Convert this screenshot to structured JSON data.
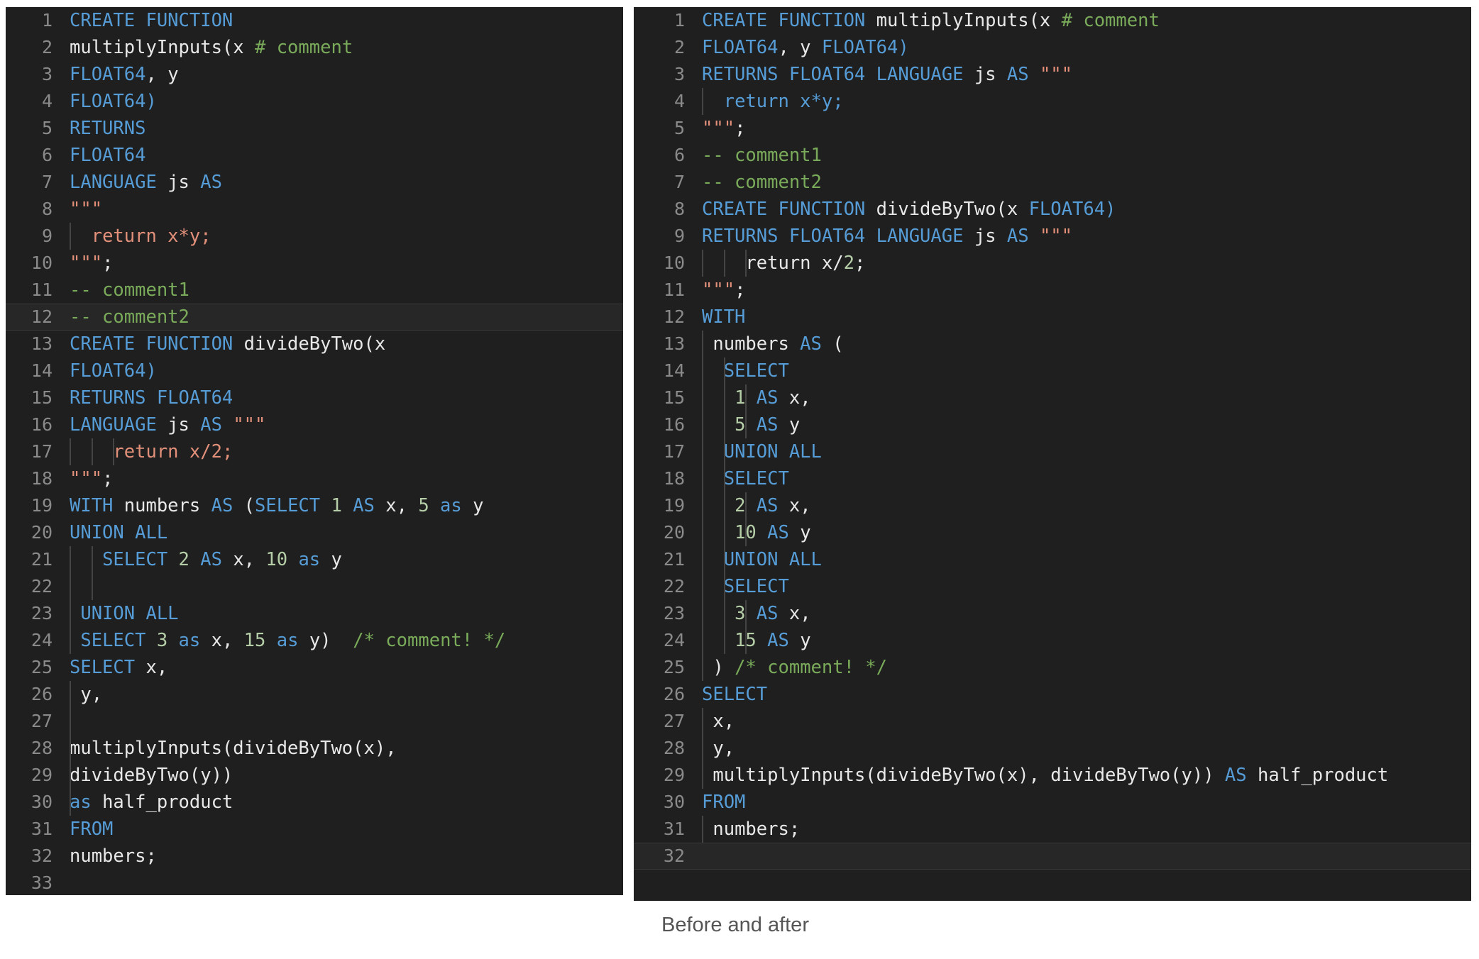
{
  "caption": "Before and after",
  "colors": {
    "editor_background": "#1f1f1f",
    "gutter_text": "#8a8a8a",
    "keyword": "#569cd6",
    "identifier": "#e8e8e8",
    "number": "#b5cea8",
    "string": "#e2907a",
    "comment": "#7aab5a",
    "current_line": "#272727",
    "indent_guide": "#444444",
    "caption_text": "#555555",
    "page_background": "#ffffff"
  },
  "editors": [
    {
      "name": "before",
      "total_lines": 33,
      "current_line": 12,
      "lines": [
        {
          "n": 1,
          "guides": 0,
          "tokens": [
            {
              "t": "CREATE FUNCTION",
              "c": "kw"
            }
          ]
        },
        {
          "n": 2,
          "guides": 0,
          "tokens": [
            {
              "t": "multiplyInputs(x ",
              "c": "id"
            },
            {
              "t": "# comment",
              "c": "com"
            }
          ]
        },
        {
          "n": 3,
          "guides": 0,
          "tokens": [
            {
              "t": "FLOAT64",
              "c": "kw"
            },
            {
              "t": ", ",
              "c": "id"
            },
            {
              "t": "y",
              "c": "id"
            }
          ]
        },
        {
          "n": 4,
          "guides": 0,
          "tokens": [
            {
              "t": "FLOAT64)",
              "c": "kw"
            }
          ]
        },
        {
          "n": 5,
          "guides": 0,
          "tokens": [
            {
              "t": "RETURNS",
              "c": "kw"
            }
          ]
        },
        {
          "n": 6,
          "guides": 0,
          "tokens": [
            {
              "t": "FLOAT64",
              "c": "kw"
            }
          ]
        },
        {
          "n": 7,
          "guides": 0,
          "tokens": [
            {
              "t": "LANGUAGE ",
              "c": "kw"
            },
            {
              "t": "js",
              "c": "id"
            },
            {
              "t": " AS",
              "c": "kw"
            }
          ]
        },
        {
          "n": 8,
          "guides": 0,
          "tokens": [
            {
              "t": "\"\"\"",
              "c": "str"
            }
          ]
        },
        {
          "n": 9,
          "guides": 1,
          "tokens": [
            {
              "t": "  ",
              "c": "plain"
            },
            {
              "t": "return x*y;",
              "c": "str"
            }
          ]
        },
        {
          "n": 10,
          "guides": 0,
          "tokens": [
            {
              "t": "\"\"\"",
              "c": "str"
            },
            {
              "t": ";",
              "c": "id"
            }
          ]
        },
        {
          "n": 11,
          "guides": 0,
          "tokens": [
            {
              "t": "-- comment1",
              "c": "com"
            }
          ]
        },
        {
          "n": 12,
          "guides": 0,
          "tokens": [
            {
              "t": "-- comment2",
              "c": "com"
            }
          ]
        },
        {
          "n": 13,
          "guides": 0,
          "tokens": [
            {
              "t": "CREATE FUNCTION ",
              "c": "kw"
            },
            {
              "t": "divideByTwo(x",
              "c": "id"
            }
          ]
        },
        {
          "n": 14,
          "guides": 0,
          "tokens": [
            {
              "t": "FLOAT64)",
              "c": "kw"
            }
          ]
        },
        {
          "n": 15,
          "guides": 0,
          "tokens": [
            {
              "t": "RETURNS FLOAT64",
              "c": "kw"
            }
          ]
        },
        {
          "n": 16,
          "guides": 0,
          "tokens": [
            {
              "t": "LANGUAGE ",
              "c": "kw"
            },
            {
              "t": "js",
              "c": "id"
            },
            {
              "t": " AS ",
              "c": "kw"
            },
            {
              "t": "\"\"\"",
              "c": "str"
            }
          ]
        },
        {
          "n": 17,
          "guides": 3,
          "tokens": [
            {
              "t": "    ",
              "c": "plain"
            },
            {
              "t": "return x/2;",
              "c": "str"
            }
          ]
        },
        {
          "n": 18,
          "guides": 0,
          "tokens": [
            {
              "t": "\"\"\"",
              "c": "str"
            },
            {
              "t": ";",
              "c": "id"
            }
          ]
        },
        {
          "n": 19,
          "guides": 0,
          "tokens": [
            {
              "t": "WITH ",
              "c": "kw"
            },
            {
              "t": "numbers",
              "c": "id"
            },
            {
              "t": " AS ",
              "c": "kw"
            },
            {
              "t": "(",
              "c": "id"
            },
            {
              "t": "SELECT ",
              "c": "kw"
            },
            {
              "t": "1",
              "c": "num"
            },
            {
              "t": " AS ",
              "c": "kw"
            },
            {
              "t": "x, ",
              "c": "id"
            },
            {
              "t": "5",
              "c": "num"
            },
            {
              "t": " as ",
              "c": "kw"
            },
            {
              "t": "y",
              "c": "id"
            }
          ]
        },
        {
          "n": 20,
          "guides": 0,
          "tokens": [
            {
              "t": "UNION ALL",
              "c": "kw"
            }
          ]
        },
        {
          "n": 21,
          "guides": 2,
          "tokens": [
            {
              "t": "   ",
              "c": "plain"
            },
            {
              "t": "SELECT ",
              "c": "kw"
            },
            {
              "t": "2",
              "c": "num"
            },
            {
              "t": " AS ",
              "c": "kw"
            },
            {
              "t": "x, ",
              "c": "id"
            },
            {
              "t": "10",
              "c": "num"
            },
            {
              "t": " as ",
              "c": "kw"
            },
            {
              "t": "y",
              "c": "id"
            }
          ]
        },
        {
          "n": 22,
          "guides": 2,
          "tokens": []
        },
        {
          "n": 23,
          "guides": 1,
          "tokens": [
            {
              "t": " ",
              "c": "plain"
            },
            {
              "t": "UNION ALL",
              "c": "kw"
            }
          ]
        },
        {
          "n": 24,
          "guides": 1,
          "tokens": [
            {
              "t": " ",
              "c": "plain"
            },
            {
              "t": "SELECT ",
              "c": "kw"
            },
            {
              "t": "3",
              "c": "num"
            },
            {
              "t": " as ",
              "c": "kw"
            },
            {
              "t": "x, ",
              "c": "id"
            },
            {
              "t": "15",
              "c": "num"
            },
            {
              "t": " as ",
              "c": "kw"
            },
            {
              "t": "y)",
              "c": "id"
            },
            {
              "t": "  ",
              "c": "plain"
            },
            {
              "t": "/* comment! */",
              "c": "com"
            }
          ]
        },
        {
          "n": 25,
          "guides": 0,
          "tokens": [
            {
              "t": "SELECT ",
              "c": "kw"
            },
            {
              "t": "x,",
              "c": "id"
            }
          ]
        },
        {
          "n": 26,
          "guides": 1,
          "tokens": [
            {
              "t": " ",
              "c": "plain"
            },
            {
              "t": "y,",
              "c": "id"
            }
          ]
        },
        {
          "n": 27,
          "guides": 1,
          "tokens": []
        },
        {
          "n": 28,
          "guides": 1,
          "tokens": [
            {
              "t": "multiplyInputs(divideByTwo(x),",
              "c": "id"
            }
          ]
        },
        {
          "n": 29,
          "guides": 1,
          "tokens": [
            {
              "t": "divideByTwo(y))",
              "c": "id"
            }
          ]
        },
        {
          "n": 30,
          "guides": 1,
          "tokens": [
            {
              "t": "as ",
              "c": "kw"
            },
            {
              "t": "half_product",
              "c": "id"
            }
          ]
        },
        {
          "n": 31,
          "guides": 0,
          "tokens": [
            {
              "t": "FROM",
              "c": "kw"
            }
          ]
        },
        {
          "n": 32,
          "guides": 0,
          "tokens": [
            {
              "t": "numbers;",
              "c": "id"
            }
          ]
        },
        {
          "n": 33,
          "guides": 0,
          "tokens": []
        }
      ]
    },
    {
      "name": "after",
      "total_lines": 32,
      "current_line": 32,
      "lines": [
        {
          "n": 1,
          "guides": 0,
          "tokens": [
            {
              "t": "CREATE FUNCTION ",
              "c": "kw"
            },
            {
              "t": "multiplyInputs(x ",
              "c": "id"
            },
            {
              "t": "# comment",
              "c": "com"
            }
          ]
        },
        {
          "n": 2,
          "guides": 0,
          "tokens": [
            {
              "t": "FLOAT64",
              "c": "kw"
            },
            {
              "t": ", y ",
              "c": "id"
            },
            {
              "t": "FLOAT64)",
              "c": "kw"
            }
          ]
        },
        {
          "n": 3,
          "guides": 0,
          "tokens": [
            {
              "t": "RETURNS FLOAT64 LANGUAGE ",
              "c": "kw"
            },
            {
              "t": "js",
              "c": "id"
            },
            {
              "t": " AS ",
              "c": "kw"
            },
            {
              "t": "\"\"\"",
              "c": "str"
            }
          ]
        },
        {
          "n": 4,
          "guides": 1,
          "tokens": [
            {
              "t": "  ",
              "c": "plain"
            },
            {
              "t": "return x*y;",
              "c": "kw"
            }
          ]
        },
        {
          "n": 5,
          "guides": 0,
          "tokens": [
            {
              "t": "\"\"\"",
              "c": "str"
            },
            {
              "t": ";",
              "c": "id"
            }
          ]
        },
        {
          "n": 6,
          "guides": 0,
          "tokens": [
            {
              "t": "-- comment1",
              "c": "com"
            }
          ]
        },
        {
          "n": 7,
          "guides": 0,
          "tokens": [
            {
              "t": "-- comment2",
              "c": "com"
            }
          ]
        },
        {
          "n": 8,
          "guides": 0,
          "tokens": [
            {
              "t": "CREATE FUNCTION ",
              "c": "kw"
            },
            {
              "t": "divideByTwo(x ",
              "c": "id"
            },
            {
              "t": "FLOAT64)",
              "c": "kw"
            }
          ]
        },
        {
          "n": 9,
          "guides": 0,
          "tokens": [
            {
              "t": "RETURNS FLOAT64 LANGUAGE ",
              "c": "kw"
            },
            {
              "t": "js",
              "c": "id"
            },
            {
              "t": " AS ",
              "c": "kw"
            },
            {
              "t": "\"\"\"",
              "c": "str"
            }
          ]
        },
        {
          "n": 10,
          "guides": 3,
          "tokens": [
            {
              "t": "    ",
              "c": "plain"
            },
            {
              "t": "return x/",
              "c": "id"
            },
            {
              "t": "2",
              "c": "num"
            },
            {
              "t": ";",
              "c": "id"
            }
          ]
        },
        {
          "n": 11,
          "guides": 0,
          "tokens": [
            {
              "t": "\"\"\"",
              "c": "str"
            },
            {
              "t": ";",
              "c": "id"
            }
          ]
        },
        {
          "n": 12,
          "guides": 0,
          "tokens": [
            {
              "t": "WITH",
              "c": "kw"
            }
          ]
        },
        {
          "n": 13,
          "guides": 1,
          "tokens": [
            {
              "t": " ",
              "c": "plain"
            },
            {
              "t": "numbers",
              "c": "id"
            },
            {
              "t": " AS ",
              "c": "kw"
            },
            {
              "t": "(",
              "c": "id"
            }
          ]
        },
        {
          "n": 14,
          "guides": 2,
          "tokens": [
            {
              "t": "  ",
              "c": "plain"
            },
            {
              "t": "SELECT",
              "c": "kw"
            }
          ]
        },
        {
          "n": 15,
          "guides": 3,
          "tokens": [
            {
              "t": "   ",
              "c": "plain"
            },
            {
              "t": "1",
              "c": "num"
            },
            {
              "t": " AS ",
              "c": "kw"
            },
            {
              "t": "x,",
              "c": "id"
            }
          ]
        },
        {
          "n": 16,
          "guides": 3,
          "tokens": [
            {
              "t": "   ",
              "c": "plain"
            },
            {
              "t": "5",
              "c": "num"
            },
            {
              "t": " AS ",
              "c": "kw"
            },
            {
              "t": "y",
              "c": "id"
            }
          ]
        },
        {
          "n": 17,
          "guides": 2,
          "tokens": [
            {
              "t": "  ",
              "c": "plain"
            },
            {
              "t": "UNION ALL",
              "c": "kw"
            }
          ]
        },
        {
          "n": 18,
          "guides": 2,
          "tokens": [
            {
              "t": "  ",
              "c": "plain"
            },
            {
              "t": "SELECT",
              "c": "kw"
            }
          ]
        },
        {
          "n": 19,
          "guides": 3,
          "tokens": [
            {
              "t": "   ",
              "c": "plain"
            },
            {
              "t": "2",
              "c": "num"
            },
            {
              "t": " AS ",
              "c": "kw"
            },
            {
              "t": "x,",
              "c": "id"
            }
          ]
        },
        {
          "n": 20,
          "guides": 3,
          "tokens": [
            {
              "t": "   ",
              "c": "plain"
            },
            {
              "t": "10",
              "c": "num"
            },
            {
              "t": " AS ",
              "c": "kw"
            },
            {
              "t": "y",
              "c": "id"
            }
          ]
        },
        {
          "n": 21,
          "guides": 2,
          "tokens": [
            {
              "t": "  ",
              "c": "plain"
            },
            {
              "t": "UNION ALL",
              "c": "kw"
            }
          ]
        },
        {
          "n": 22,
          "guides": 2,
          "tokens": [
            {
              "t": "  ",
              "c": "plain"
            },
            {
              "t": "SELECT",
              "c": "kw"
            }
          ]
        },
        {
          "n": 23,
          "guides": 3,
          "tokens": [
            {
              "t": "   ",
              "c": "plain"
            },
            {
              "t": "3",
              "c": "num"
            },
            {
              "t": " AS ",
              "c": "kw"
            },
            {
              "t": "x,",
              "c": "id"
            }
          ]
        },
        {
          "n": 24,
          "guides": 3,
          "tokens": [
            {
              "t": "   ",
              "c": "plain"
            },
            {
              "t": "15",
              "c": "num"
            },
            {
              "t": " AS ",
              "c": "kw"
            },
            {
              "t": "y",
              "c": "id"
            }
          ]
        },
        {
          "n": 25,
          "guides": 1,
          "tokens": [
            {
              "t": " ",
              "c": "plain"
            },
            {
              "t": ")",
              "c": "id"
            },
            {
              "t": " ",
              "c": "plain"
            },
            {
              "t": "/* comment! */",
              "c": "com"
            }
          ]
        },
        {
          "n": 26,
          "guides": 0,
          "tokens": [
            {
              "t": "SELECT",
              "c": "kw"
            }
          ]
        },
        {
          "n": 27,
          "guides": 1,
          "tokens": [
            {
              "t": " ",
              "c": "plain"
            },
            {
              "t": "x,",
              "c": "id"
            }
          ]
        },
        {
          "n": 28,
          "guides": 1,
          "tokens": [
            {
              "t": " ",
              "c": "plain"
            },
            {
              "t": "y,",
              "c": "id"
            }
          ]
        },
        {
          "n": 29,
          "guides": 1,
          "tokens": [
            {
              "t": " ",
              "c": "plain"
            },
            {
              "t": "multiplyInputs(divideByTwo(x), divideByTwo(y))",
              "c": "id"
            },
            {
              "t": " AS ",
              "c": "kw"
            },
            {
              "t": "half_product",
              "c": "id"
            }
          ]
        },
        {
          "n": 30,
          "guides": 0,
          "tokens": [
            {
              "t": "FROM",
              "c": "kw"
            }
          ]
        },
        {
          "n": 31,
          "guides": 1,
          "tokens": [
            {
              "t": " ",
              "c": "plain"
            },
            {
              "t": "numbers;",
              "c": "id"
            }
          ]
        },
        {
          "n": 32,
          "guides": 0,
          "tokens": []
        }
      ]
    }
  ]
}
